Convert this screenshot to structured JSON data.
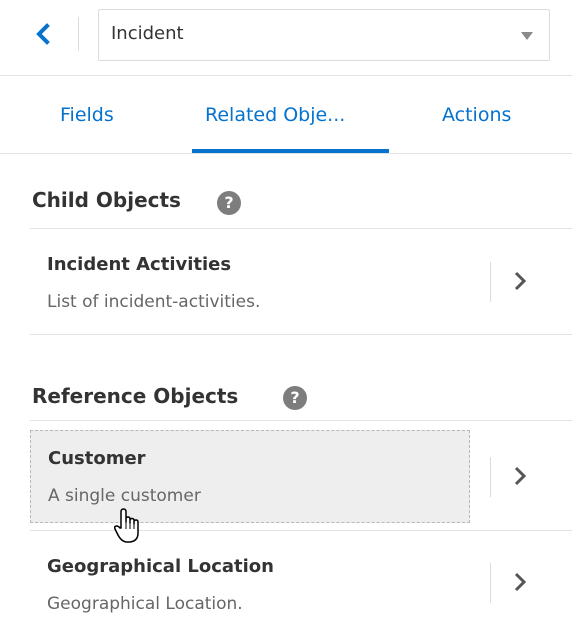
{
  "header": {
    "back_icon": "chevron-left-icon",
    "object_select": {
      "value": "Incident"
    }
  },
  "tabs": [
    {
      "label": "Fields"
    },
    {
      "label": "Related Obje..."
    },
    {
      "label": "Actions"
    }
  ],
  "child_section": {
    "heading": "Child Objects",
    "help_icon": "question-icon",
    "items": [
      {
        "title": "Incident Activities",
        "description": "List of incident-activities."
      }
    ]
  },
  "reference_section": {
    "heading": "Reference Objects",
    "help_icon": "question-icon",
    "items": [
      {
        "title": "Customer",
        "description": "A single customer"
      },
      {
        "title": "Geographical Location",
        "description": "Geographical Location."
      }
    ]
  },
  "colors": {
    "accent": "#0572ce",
    "hover_background": "#eeeeee"
  }
}
